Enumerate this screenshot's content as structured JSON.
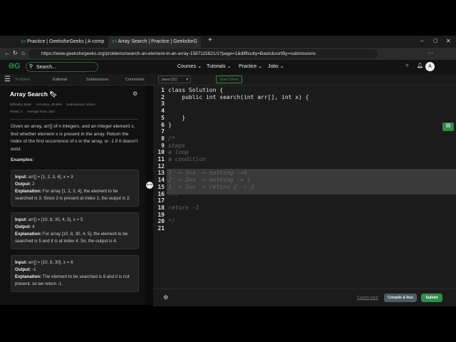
{
  "browser": {
    "tabs": [
      "Practice | GeeksforGeeks | A comp",
      "Array Search | Practice | GeeksforG"
    ],
    "url": "https://www.geeksforgeeks.org/problems/search-an-element-in-an-array-1587115621/1?page=1&difficulty=Basic&sortBy=submissions"
  },
  "header": {
    "search_placeholder": "Search...",
    "nav": [
      "Courses",
      "Tutorials",
      "Practice",
      "Jobs"
    ],
    "avatar": "A"
  },
  "subnav": {
    "tabs": [
      "Problem",
      "Editorial",
      "Submissions",
      "Comments"
    ],
    "language": "Java (21)",
    "timer": "Start Timer"
  },
  "problem": {
    "title": "Array Search",
    "difficulty": "Difficulty: Basic",
    "accuracy": "Accuracy: 40.98%",
    "submissions": "Submissions: 814K+",
    "points": "Points: 1",
    "avg_time": "Average Time: 15m",
    "description": "Given an array, arr[] of n integers, and an integer element x, find whether element x is present in the array. Return the index of the first occurrence of x in the array, or -1 if it doesn't exist.",
    "examples_label": "Examples:",
    "examples": [
      {
        "input": "arr[] = [1, 2, 3, 4], x = 3",
        "output": "2",
        "explanation": "For array [1, 2, 3, 4], the element to be searched is 3. Since 3 is present at index 2, the output is 2."
      },
      {
        "input": "arr[] = [10, 8, 30, 4, 5], x = 5",
        "output": "4",
        "explanation": "For array [10, 8, 30, 4, 5], the element to be searched is 5 and it is at index 4. So, the output is 4."
      },
      {
        "input": "arr[] = [10, 8, 30], x = 6",
        "output": "-1",
        "explanation": "The element to be searched is 6 and it is not present, so we return -1."
      }
    ],
    "labels": {
      "input": "Input:",
      "output": "Output:",
      "explanation": "Explanation:"
    }
  },
  "code": [
    "class Solution {",
    "    public int search(int arr[], int x) {",
    "",
    "",
    "    }",
    "}",
    "",
    "/*",
    "steps",
    "a loop",
    "a condition",
    "",
    "1 -> 1=x -> nothing ->0",
    "2 -> 2=x -> nothing -> 1",
    "3 -> 3=x -> return 2 -> 2",
    "...",
    "",
    "return -1",
    "",
    "*/",
    ""
  ],
  "actions": {
    "custom_input": "Custom Input",
    "compile": "Compile & Run",
    "submit": "Submit"
  },
  "colors": {
    "accent": "#2f8d46"
  }
}
